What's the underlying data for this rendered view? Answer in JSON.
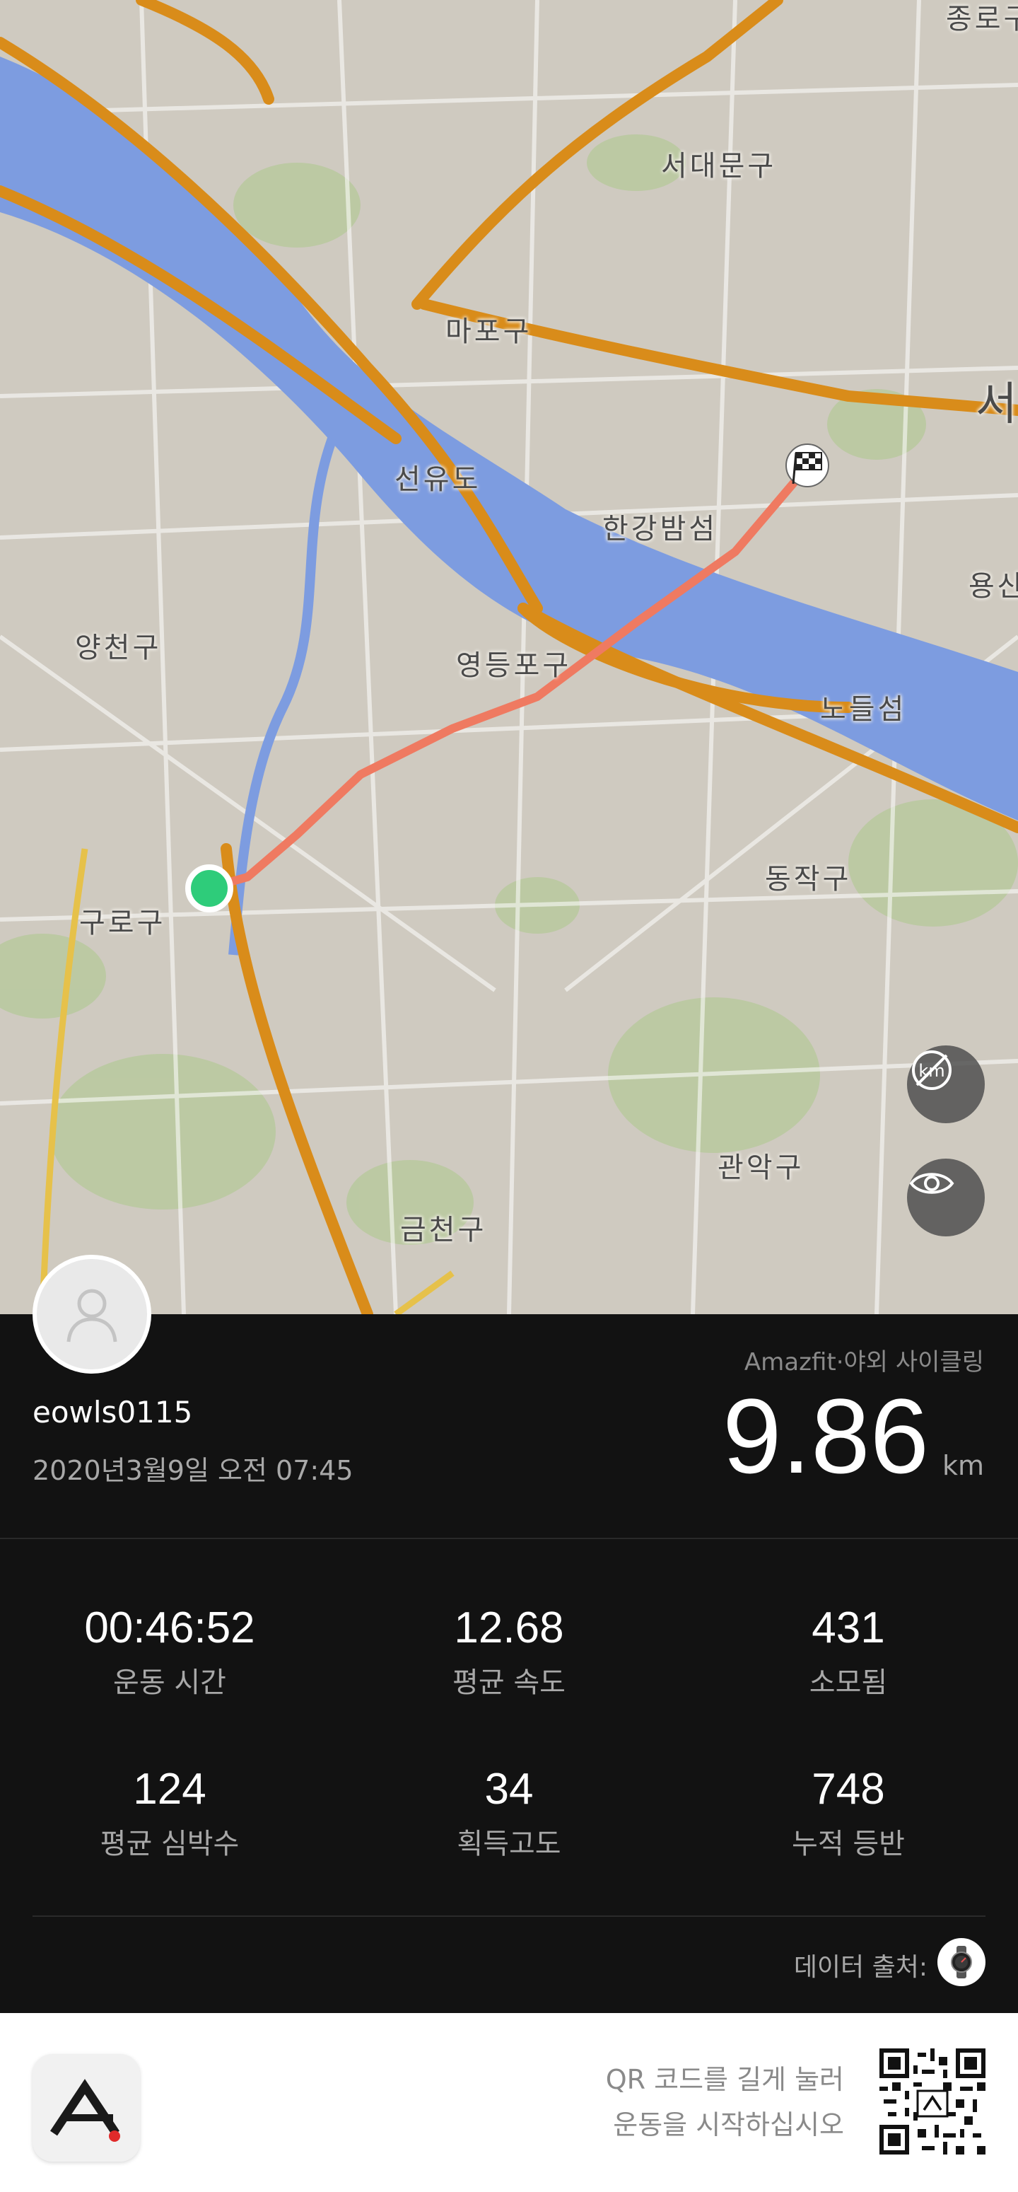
{
  "map": {
    "labels": {
      "jongno": "종로구",
      "seodaemun": "서대문구",
      "mapo": "마포구",
      "seo": "서",
      "seonyudo": "선유도",
      "hangangbamseom": "한강밤섬",
      "yongsan": "용산",
      "yangcheon": "양천구",
      "yeongdeungpo": "영등포구",
      "nodeulseom": "노들섬",
      "dongjak": "동작구",
      "guro": "구로구",
      "gwanak": "관악구",
      "geumcheon": "금천구"
    },
    "colors": {
      "route": "#ef7a61",
      "start": "#2ecc7a",
      "river": "#7d9ce0",
      "highway": "#d98c1a"
    }
  },
  "activity": {
    "username": "eowls0115",
    "datetime": "2020년3월9일 오전 07:45",
    "device": "Amazfit·야외 사이클링",
    "distance": "9.86",
    "distance_unit": "km"
  },
  "stats": [
    {
      "value": "00:46:52",
      "label": "운동 시간"
    },
    {
      "value": "12.68",
      "label": "평균 속도"
    },
    {
      "value": "431",
      "label": "소모됨"
    },
    {
      "value": "124",
      "label": "평균 심박수"
    },
    {
      "value": "34",
      "label": "획득고도"
    },
    {
      "value": "748",
      "label": "누적 등반"
    }
  ],
  "source_label": "데이터 출처:",
  "footer": {
    "qr_line1": "QR 코드를 길게 눌러",
    "qr_line2": "운동을 시작하십시오"
  }
}
